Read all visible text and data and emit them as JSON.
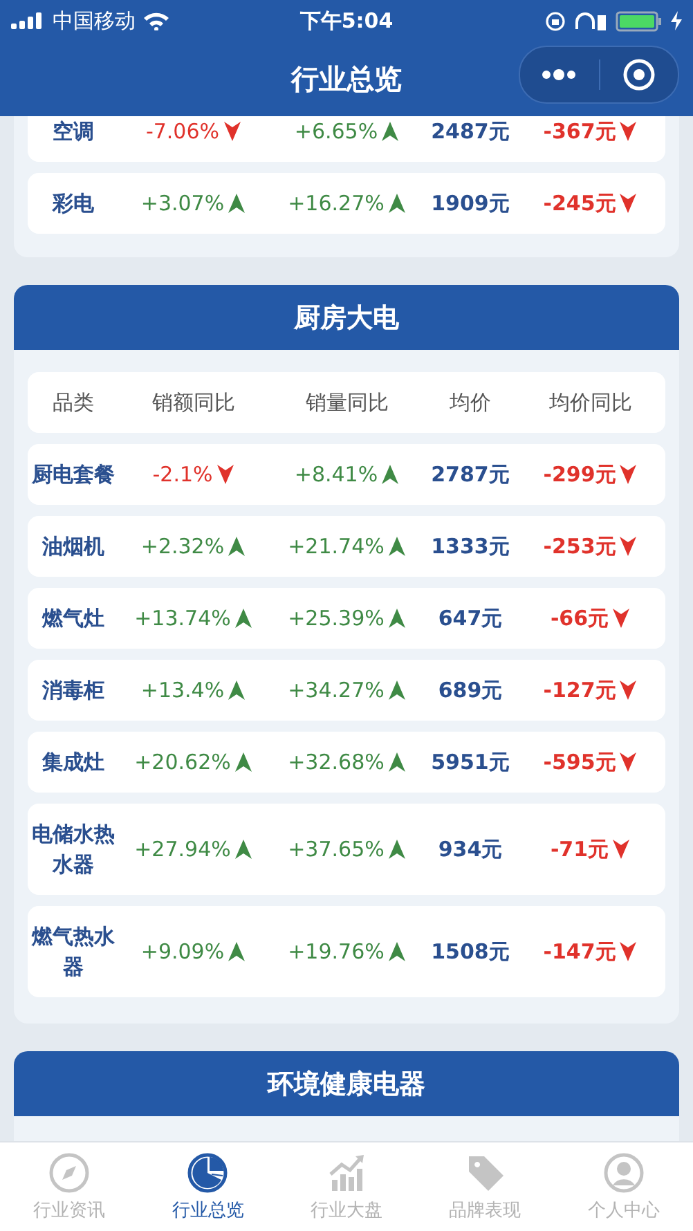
{
  "status_bar": {
    "carrier": "中国移动",
    "time": "下午5:04"
  },
  "header": {
    "title": "行业总览"
  },
  "sections": [
    {
      "rows": [
        {
          "category": "空调",
          "sales_yoy": {
            "text": "-7.06%",
            "up": false
          },
          "volume_yoy": {
            "text": "+6.65%",
            "up": true
          },
          "avg_price": "2487元",
          "avg_price_yoy": {
            "text": "-367元",
            "up": false
          }
        },
        {
          "category": "彩电",
          "sales_yoy": {
            "text": "+3.07%",
            "up": true
          },
          "volume_yoy": {
            "text": "+16.27%",
            "up": true
          },
          "avg_price": "1909元",
          "avg_price_yoy": {
            "text": "-245元",
            "up": false
          }
        }
      ]
    },
    {
      "title": "厨房大电",
      "columns": [
        "品类",
        "销额同比",
        "销量同比",
        "均价",
        "均价同比"
      ],
      "rows": [
        {
          "category": "厨电套餐",
          "sales_yoy": {
            "text": "-2.1%",
            "up": false
          },
          "volume_yoy": {
            "text": "+8.41%",
            "up": true
          },
          "avg_price": "2787元",
          "avg_price_yoy": {
            "text": "-299元",
            "up": false
          }
        },
        {
          "category": "油烟机",
          "sales_yoy": {
            "text": "+2.32%",
            "up": true
          },
          "volume_yoy": {
            "text": "+21.74%",
            "up": true
          },
          "avg_price": "1333元",
          "avg_price_yoy": {
            "text": "-253元",
            "up": false
          }
        },
        {
          "category": "燃气灶",
          "sales_yoy": {
            "text": "+13.74%",
            "up": true
          },
          "volume_yoy": {
            "text": "+25.39%",
            "up": true
          },
          "avg_price": "647元",
          "avg_price_yoy": {
            "text": "-66元",
            "up": false
          }
        },
        {
          "category": "消毒柜",
          "sales_yoy": {
            "text": "+13.4%",
            "up": true
          },
          "volume_yoy": {
            "text": "+34.27%",
            "up": true
          },
          "avg_price": "689元",
          "avg_price_yoy": {
            "text": "-127元",
            "up": false
          }
        },
        {
          "category": "集成灶",
          "sales_yoy": {
            "text": "+20.62%",
            "up": true
          },
          "volume_yoy": {
            "text": "+32.68%",
            "up": true
          },
          "avg_price": "5951元",
          "avg_price_yoy": {
            "text": "-595元",
            "up": false
          }
        },
        {
          "category": "电储水热水器",
          "sales_yoy": {
            "text": "+27.94%",
            "up": true
          },
          "volume_yoy": {
            "text": "+37.65%",
            "up": true
          },
          "avg_price": "934元",
          "avg_price_yoy": {
            "text": "-71元",
            "up": false
          }
        },
        {
          "category": "燃气热水器",
          "sales_yoy": {
            "text": "+9.09%",
            "up": true
          },
          "volume_yoy": {
            "text": "+19.76%",
            "up": true
          },
          "avg_price": "1508元",
          "avg_price_yoy": {
            "text": "-147元",
            "up": false
          }
        }
      ]
    },
    {
      "title": "环境健康电器"
    }
  ],
  "tab_bar": [
    {
      "label": "行业资讯",
      "selected": false
    },
    {
      "label": "行业总览",
      "selected": true
    },
    {
      "label": "行业大盘",
      "selected": false
    },
    {
      "label": "品牌表现",
      "selected": false
    },
    {
      "label": "个人中心",
      "selected": false
    }
  ]
}
